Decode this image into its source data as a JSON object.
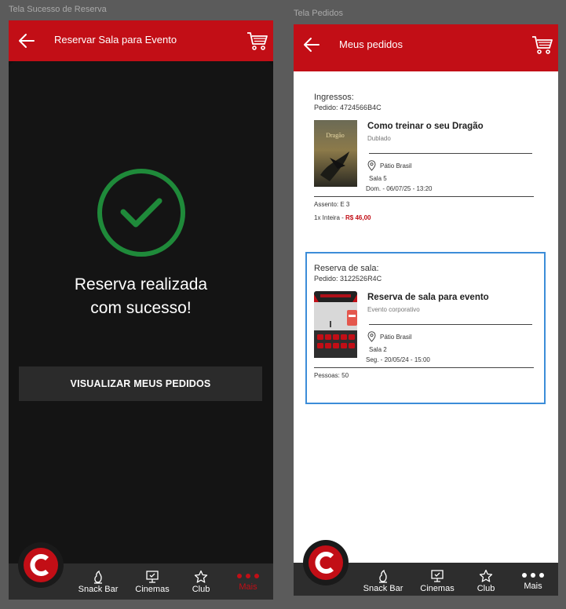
{
  "frames": {
    "left_label": "Tela Sucesso de Reserva",
    "right_label": "Tela Pedidos"
  },
  "left": {
    "header_title": "Reservar Sala para Evento",
    "success_line1": "Reserva realizada",
    "success_line2": "com sucesso!",
    "button_label": "VISUALIZAR MEUS PEDIDOS"
  },
  "right": {
    "header_title": "Meus pedidos",
    "orders": [
      {
        "kind": "Ingressos:",
        "code": "Pedido: 4724566B4C",
        "title": "Como treinar o seu Dragão",
        "subtitle": "Dublado",
        "location": "Pátio Brasil",
        "room": "Sala 5",
        "datetime": "Dom. - 06/07/25 - 13:20",
        "seat": "Assento: E 3",
        "qty": "1x Inteira - ",
        "price": "R$ 46,00"
      },
      {
        "kind": "Reserva de sala:",
        "code": "Pedido: 3122526R4C",
        "title": "Reserva de sala para evento",
        "subtitle": "Evento corporativo",
        "location": "Pátio Brasil",
        "room": "Sala 2",
        "datetime": "Seg. - 20/05/24 - 15:00",
        "people": "Pessoas: 50"
      }
    ]
  },
  "nav": {
    "items": [
      "Snack Bar",
      "Cinemas",
      "Club",
      "Mais"
    ],
    "icons": [
      "snack-bar-icon",
      "cinemas-icon",
      "star-icon",
      "more-icon"
    ],
    "active_left": "Mais"
  },
  "colors": {
    "brand_red": "#c20e16",
    "success_green": "#1f8a3a",
    "selection_blue": "#3c8dd8",
    "dark_bg": "#141414",
    "nav_bg": "#2d2d2d"
  }
}
